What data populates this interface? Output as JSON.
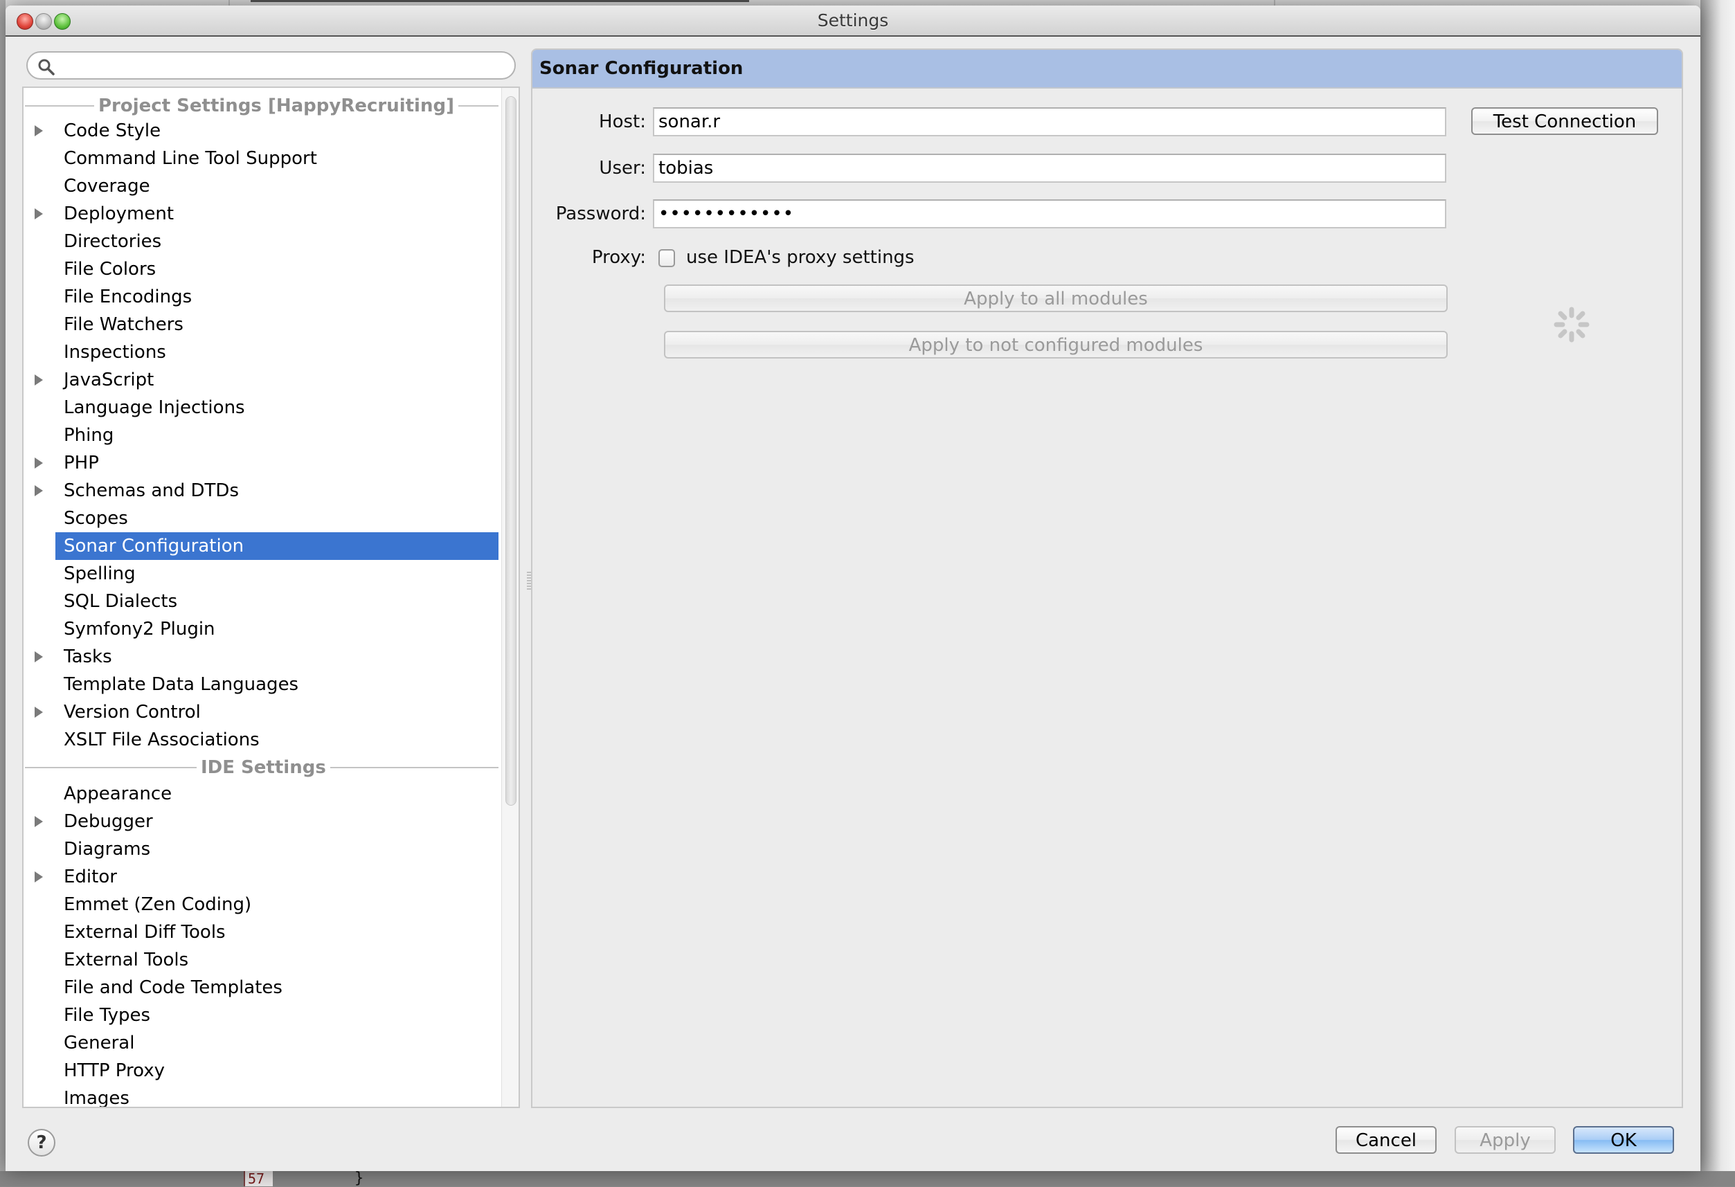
{
  "window": {
    "title": "Settings"
  },
  "search": {
    "value": "",
    "placeholder": ""
  },
  "tree": {
    "groups": [
      {
        "header": "Project Settings [HappyRecruiting]",
        "items": [
          {
            "label": "Code Style",
            "expandable": true
          },
          {
            "label": "Command Line Tool Support",
            "expandable": false
          },
          {
            "label": "Coverage",
            "expandable": false
          },
          {
            "label": "Deployment",
            "expandable": true
          },
          {
            "label": "Directories",
            "expandable": false
          },
          {
            "label": "File Colors",
            "expandable": false
          },
          {
            "label": "File Encodings",
            "expandable": false
          },
          {
            "label": "File Watchers",
            "expandable": false
          },
          {
            "label": "Inspections",
            "expandable": false
          },
          {
            "label": "JavaScript",
            "expandable": true
          },
          {
            "label": "Language Injections",
            "expandable": false
          },
          {
            "label": "Phing",
            "expandable": false
          },
          {
            "label": "PHP",
            "expandable": true
          },
          {
            "label": "Schemas and DTDs",
            "expandable": true
          },
          {
            "label": "Scopes",
            "expandable": false
          },
          {
            "label": "Sonar Configuration",
            "expandable": false,
            "selected": true
          },
          {
            "label": "Spelling",
            "expandable": false
          },
          {
            "label": "SQL Dialects",
            "expandable": false
          },
          {
            "label": "Symfony2 Plugin",
            "expandable": false
          },
          {
            "label": "Tasks",
            "expandable": true
          },
          {
            "label": "Template Data Languages",
            "expandable": false
          },
          {
            "label": "Version Control",
            "expandable": true
          },
          {
            "label": "XSLT File Associations",
            "expandable": false
          }
        ]
      },
      {
        "header": "IDE Settings",
        "items": [
          {
            "label": "Appearance",
            "expandable": false
          },
          {
            "label": "Debugger",
            "expandable": true
          },
          {
            "label": "Diagrams",
            "expandable": false
          },
          {
            "label": "Editor",
            "expandable": true
          },
          {
            "label": "Emmet (Zen Coding)",
            "expandable": false
          },
          {
            "label": "External Diff Tools",
            "expandable": false
          },
          {
            "label": "External Tools",
            "expandable": false
          },
          {
            "label": "File and Code Templates",
            "expandable": false
          },
          {
            "label": "File Types",
            "expandable": false
          },
          {
            "label": "General",
            "expandable": false
          },
          {
            "label": "HTTP Proxy",
            "expandable": false
          },
          {
            "label": "Images",
            "expandable": false
          }
        ]
      }
    ]
  },
  "panel": {
    "title": "Sonar Configuration",
    "host": {
      "label": "Host:",
      "value": "sonar.r"
    },
    "user": {
      "label": "User:",
      "value": "tobias"
    },
    "password": {
      "label": "Password:",
      "value": "••••••••••••",
      "masked_length": 12
    },
    "proxy": {
      "label": "Proxy:",
      "checkbox_label": "use IDEA's proxy settings",
      "checked": false
    },
    "test_connection_label": "Test Connection",
    "apply_all_label": "Apply to all modules",
    "apply_not_configured_label": "Apply to not configured modules",
    "loading": true
  },
  "footer": {
    "help_label": "?",
    "cancel_label": "Cancel",
    "apply_label": "Apply",
    "ok_label": "OK"
  },
  "background": {
    "line_number": "57",
    "code_fragment": "}"
  },
  "colors": {
    "selection": "#3b75d0",
    "panel_header": "#a9bfe4",
    "default_button": "#86bcf3"
  }
}
